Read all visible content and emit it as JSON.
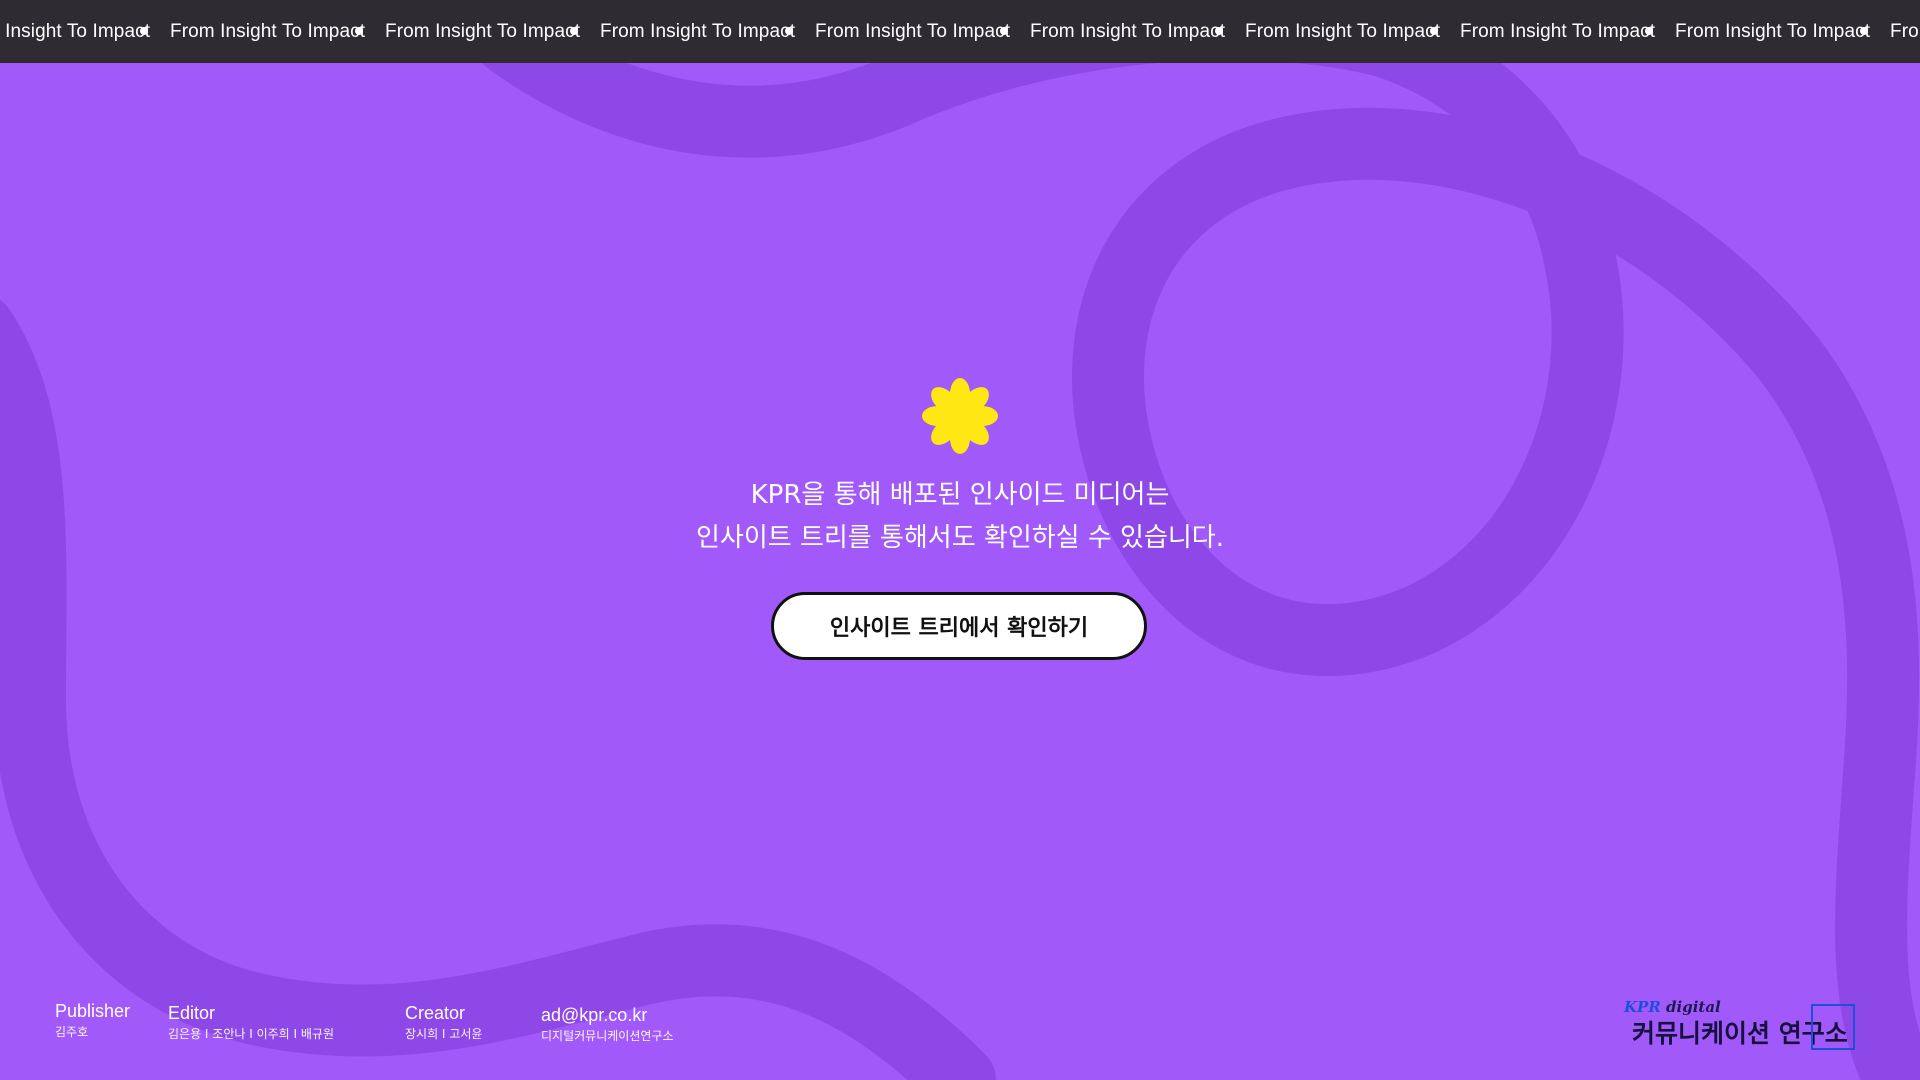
{
  "ticker": {
    "text": "From Insight To Impact",
    "items": [
      "From Insight To Impact",
      "From Insight To Impact",
      "From Insight To Impact",
      "From Insight To Impact",
      "From Insight To Impact",
      "From Insight To Impact",
      "From Insight To Impact",
      "From Insight To Impact",
      "From Insight To Impact",
      "From Insight To Impact"
    ]
  },
  "main": {
    "line1": "KPR을 통해 배포된 인사이드 미디어는",
    "line2": "인사이트 트리를 통해서도 확인하실 수 있습니다.",
    "cta_label": "인사이트 트리에서 확인하기"
  },
  "footer": {
    "publisher": {
      "title": "Publisher",
      "names": "김주호"
    },
    "editor": {
      "title": "Editor",
      "names": "김은용  I  조안나  I  이주희  I  배규원"
    },
    "creator": {
      "title": "Creator",
      "names": "장시희  I  고서윤"
    },
    "contact": {
      "email": "ad@kpr.co.kr",
      "org": "디지털커뮤니케이션연구소"
    }
  },
  "brand": {
    "kpr": "KPR",
    "digital": "digital",
    "name": "커뮤니케이션 연구소"
  },
  "colors": {
    "background": "#a259fa",
    "ticker_bg": "#2e2b33",
    "flower": "#ffe713",
    "swirl": "#8f48e8",
    "brand_blue": "#1e4fd8"
  },
  "icons": {
    "flower": "flower-icon",
    "ticker_separator": "dot-icon"
  }
}
